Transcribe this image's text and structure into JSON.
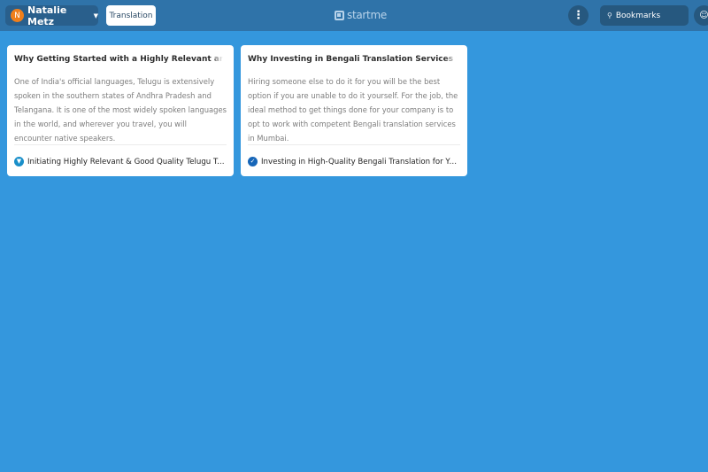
{
  "header": {
    "user": {
      "initial": "N",
      "name": "Natalie Metz"
    },
    "active_tab": "Translation",
    "logo_text": "startme",
    "search": {
      "placeholder": "Bookmarks"
    }
  },
  "cards": [
    {
      "title": "Why Getting Started with a Highly Relevant and",
      "description": "One of India's official languages, Telugu is extensively spoken in the southern states of Andhra Pradesh and Telangana. It is one of the most widely spoken languages in the world, and wherever you travel, you will encounter native speakers.",
      "link_label": "Initiating Highly Relevant & Good Quality Telugu Translation",
      "favicon_color": "#1a8fc9"
    },
    {
      "title": "Why Investing in Bengali Translation Services for",
      "description": "Hiring someone else to do it for you will be the best option if you are unable to do it yourself. For the job, the ideal method to get things done for your company is to opt to work with competent Bengali translation services in Mumbai.",
      "link_label": "Investing in High-Quality Bengali Translation for Your Business",
      "favicon_color": "#1766b8"
    }
  ],
  "colors": {
    "background": "#3497dd",
    "topbar": "#2f73a9",
    "avatar": "#f07f1b"
  }
}
